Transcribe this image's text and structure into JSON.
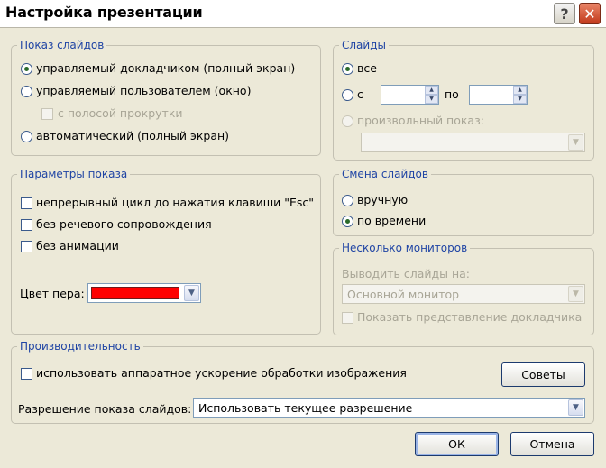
{
  "window": {
    "title": "Настройка презентации",
    "help_label": "?",
    "close_label": "✕"
  },
  "show_type": {
    "legend": "Показ слайдов",
    "presenter": "управляемый докладчиком (полный экран)",
    "individual": "управляемый пользователем (окно)",
    "scrollbar": "с полосой прокрутки",
    "kiosk": "автоматический (полный экран)",
    "selected": "presenter"
  },
  "slides": {
    "legend": "Слайды",
    "all": "все",
    "from": "с",
    "to": "по",
    "from_value": "",
    "to_value": "",
    "custom": "произвольный показ:",
    "custom_value": "",
    "selected": "all"
  },
  "show_options": {
    "legend": "Параметры показа",
    "loop": "непрерывный цикл до нажатия клавиши \"Esc\"",
    "no_narration": "без речевого сопровождения",
    "no_animation": "без анимации",
    "pen_color_label": "Цвет пера:",
    "pen_color": "#ff0000"
  },
  "advance": {
    "legend": "Смена слайдов",
    "manual": "вручную",
    "timings": "по времени",
    "selected": "timings"
  },
  "monitors": {
    "legend": "Несколько мониторов",
    "display_on": "Выводить слайды на:",
    "monitor_value": "Основной монитор",
    "presenter_view": "Показать представление докладчика"
  },
  "performance": {
    "legend": "Производительность",
    "hw_accel": "использовать аппаратное ускорение обработки изображения",
    "tips_button": "Советы",
    "resolution_label": "Разрешение показа слайдов:",
    "resolution_value": "Использовать текущее разрешение"
  },
  "footer": {
    "ok": "ОК",
    "cancel": "Отмена"
  }
}
